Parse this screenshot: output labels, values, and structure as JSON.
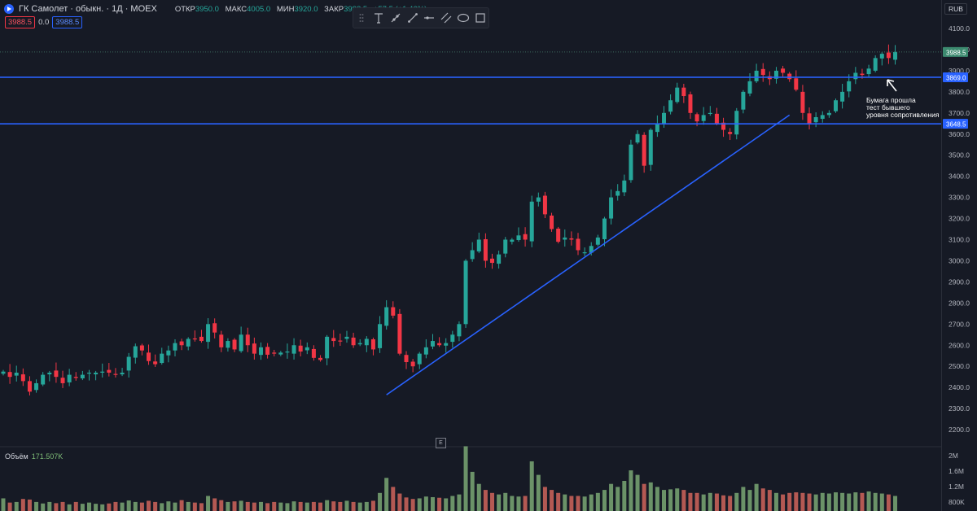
{
  "header": {
    "title": "ГК Самолет · обыкн. · 1Д · MOEX",
    "ohlc": [
      {
        "label": "ОТКР",
        "value": "3950.0"
      },
      {
        "label": "МАКС",
        "value": "4005.0"
      },
      {
        "label": "МИН",
        "value": "3920.0"
      },
      {
        "label": "ЗАКР",
        "value": "3988.5"
      }
    ],
    "change": "+57.5 (+1.46%)",
    "badges": {
      "sell": "3988.5",
      "spread": "0.0",
      "buy": "3988.5"
    }
  },
  "currency": "RUB",
  "toolbar": [
    "text-tool",
    "ray-tool",
    "trend-line-tool",
    "horizontal-ray-tool",
    "parallel-channel-tool",
    "ellipse-tool",
    "rectangle-tool"
  ],
  "volume": {
    "label": "Объём",
    "value": "171.507K"
  },
  "e_marker": "E",
  "annotation": "Бумага прошла\nтест бывшего\nуровня сопротивления",
  "colors": {
    "up": "#26a69a",
    "down": "#f23645",
    "line": "#2962ff",
    "background": "#161a25"
  },
  "chart_data": {
    "type": "candlestick",
    "ylim": [
      2150,
      4150
    ],
    "yticks": [
      2200,
      2300,
      2400,
      2500,
      2600,
      2700,
      2800,
      2900,
      3000,
      3100,
      3200,
      3300,
      3400,
      3500,
      3600,
      3700,
      3800,
      3900,
      4000,
      4100
    ],
    "last_price": 3988.5,
    "levels": [
      3869.0,
      3648.5
    ],
    "trendline": [
      {
        "bar": 58,
        "price": 2365
      },
      {
        "bar": 119,
        "price": 3690
      }
    ],
    "volume_ticks": [
      "2M",
      "1.6M",
      "1.2M",
      "800K"
    ],
    "close": [
      2475,
      2450,
      2470,
      2430,
      2380,
      2420,
      2460,
      2470,
      2450,
      2420,
      2460,
      2445,
      2460,
      2470,
      2470,
      2475,
      2470,
      2460,
      2470,
      2545,
      2595,
      2575,
      2525,
      2510,
      2560,
      2575,
      2610,
      2600,
      2630,
      2630,
      2620,
      2700,
      2660,
      2590,
      2620,
      2580,
      2650,
      2600,
      2560,
      2590,
      2555,
      2560,
      2565,
      2570,
      2600,
      2570,
      2590,
      2540,
      2530,
      2640,
      2620,
      2620,
      2640,
      2600,
      2610,
      2630,
      2580,
      2700,
      2780,
      2740,
      2560,
      2520,
      2500,
      2560,
      2590,
      2620,
      2600,
      2610,
      2650,
      2700,
      3000,
      3050,
      3100,
      3000,
      2990,
      3030,
      3100,
      3100,
      3120,
      3100,
      3280,
      3300,
      3220,
      3150,
      3090,
      3110,
      3100,
      3050,
      3040,
      3070,
      3110,
      3200,
      3300,
      3330,
      3380,
      3550,
      3600,
      3450,
      3620,
      3650,
      3700,
      3760,
      3820,
      3780,
      3700,
      3660,
      3690,
      3700,
      3650,
      3620,
      3600,
      3710,
      3800,
      3850,
      3900,
      3880,
      3860,
      3900,
      3890,
      3860,
      3810,
      3700,
      3650,
      3680,
      3690,
      3700,
      3760,
      3800,
      3850,
      3890,
      3880,
      3910,
      3960,
      3980,
      3960,
      3988.5
    ],
    "volumes": [
      0.42,
      0.28,
      0.3,
      0.4,
      0.38,
      0.3,
      0.25,
      0.3,
      0.26,
      0.3,
      0.22,
      0.3,
      0.24,
      0.28,
      0.24,
      0.22,
      0.25,
      0.3,
      0.28,
      0.35,
      0.3,
      0.28,
      0.34,
      0.3,
      0.26,
      0.32,
      0.28,
      0.36,
      0.3,
      0.28,
      0.26,
      0.5,
      0.42,
      0.36,
      0.3,
      0.32,
      0.34,
      0.3,
      0.28,
      0.3,
      0.26,
      0.3,
      0.28,
      0.26,
      0.32,
      0.3,
      0.28,
      0.3,
      0.28,
      0.36,
      0.32,
      0.3,
      0.34,
      0.3,
      0.28,
      0.3,
      0.34,
      0.6,
      1.1,
      0.8,
      0.58,
      0.45,
      0.4,
      0.42,
      0.48,
      0.46,
      0.44,
      0.42,
      0.5,
      0.55,
      2.15,
      1.3,
      0.9,
      0.7,
      0.6,
      0.55,
      0.6,
      0.5,
      0.48,
      0.5,
      1.65,
      1.2,
      0.8,
      0.7,
      0.6,
      0.55,
      0.5,
      0.5,
      0.48,
      0.55,
      0.6,
      0.7,
      0.9,
      0.8,
      1.0,
      1.35,
      1.2,
      0.9,
      0.95,
      0.8,
      0.7,
      0.72,
      0.75,
      0.7,
      0.6,
      0.6,
      0.55,
      0.6,
      0.58,
      0.52,
      0.5,
      0.6,
      0.8,
      0.7,
      0.9,
      0.75,
      0.7,
      0.6,
      0.55,
      0.6,
      0.62,
      0.6,
      0.58,
      0.55,
      0.6,
      0.58,
      0.62,
      0.6,
      0.58,
      0.62,
      0.6,
      0.65,
      0.6,
      0.58,
      0.55,
      0.5
    ]
  }
}
